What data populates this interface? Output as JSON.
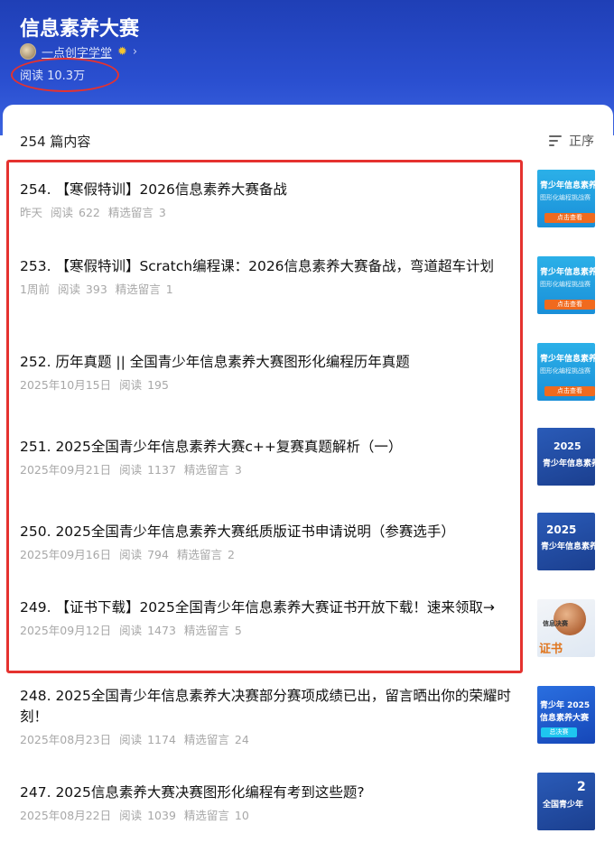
{
  "header": {
    "title": "信息素养大赛",
    "author": "一点创字学堂",
    "verified_icon": "verified-badge-icon",
    "chevron_icon": "chevron-right-icon",
    "reads": "阅读 10.3万",
    "bg_color": "#2a4fd0"
  },
  "list_header": {
    "count": "254 篇内容",
    "sort_label": "正序",
    "sort_icon": "sort-lines-icon"
  },
  "annotation_color": "#e5322f",
  "articles": [
    {
      "title": "254. 【寒假特训】2026信息素养大赛备战",
      "date": "昨天",
      "reads": "阅读 622",
      "comments": "精选留言 3",
      "thumb": {
        "l1": "青少年信息素养",
        "l2": "图形化编程挑战赛",
        "btn": "点击查看"
      }
    },
    {
      "title": "253. 【寒假特训】Scratch编程课：2026信息素养大赛备战，弯道超车计划",
      "date": "1周前",
      "reads": "阅读 393",
      "comments": "精选留言 1",
      "thumb": {
        "l1": "青少年信息素养",
        "l2": "图形化编程挑战赛",
        "btn": "点击查看"
      }
    },
    {
      "title": "252. 历年真题 || 全国青少年信息素养大赛图形化编程历年真题",
      "date": "2025年10月15日",
      "reads": "阅读 195",
      "comments": "",
      "thumb": {
        "l1": "青少年信息素养",
        "l2": "图形化编程挑战赛",
        "btn": "点击查看"
      }
    },
    {
      "title": "251. 2025全国青少年信息素养大赛c++复赛真题解析（一）",
      "date": "2025年09月21日",
      "reads": "阅读 1137",
      "comments": "精选留言 3",
      "thumb": {
        "l1": "2025",
        "l2": "青少年信息素养"
      }
    },
    {
      "title": "250. 2025全国青少年信息素养大赛纸质版证书申请说明（参赛选手）",
      "date": "2025年09月16日",
      "reads": "阅读 794",
      "comments": "精选留言 2",
      "thumb": {
        "l1": "2025",
        "l2": "青少年信息素养"
      }
    },
    {
      "title": "249. 【证书下载】2025全国青少年信息素养大赛证书开放下载！速来领取→",
      "date": "2025年09月12日",
      "reads": "阅读 1473",
      "comments": "精选留言 5",
      "thumb": {
        "l1": "信息决赛",
        "l2": "证书"
      }
    },
    {
      "title": "248. 2025全国青少年信息素养大决赛部分赛项成绩已出，留言晒出你的荣耀时刻！",
      "date": "2025年08月23日",
      "reads": "阅读 1174",
      "comments": "精选留言 24",
      "thumb": {
        "l1": "青少年 2025",
        "l2": "信息素养大赛",
        "btn": "总决赛"
      }
    },
    {
      "title": "247. 2025信息素养大赛决赛图形化编程有考到这些题?",
      "date": "2025年08月22日",
      "reads": "阅读 1039",
      "comments": "精选留言 10",
      "thumb": {
        "l1": "2",
        "l2": "全国青少年"
      }
    }
  ]
}
